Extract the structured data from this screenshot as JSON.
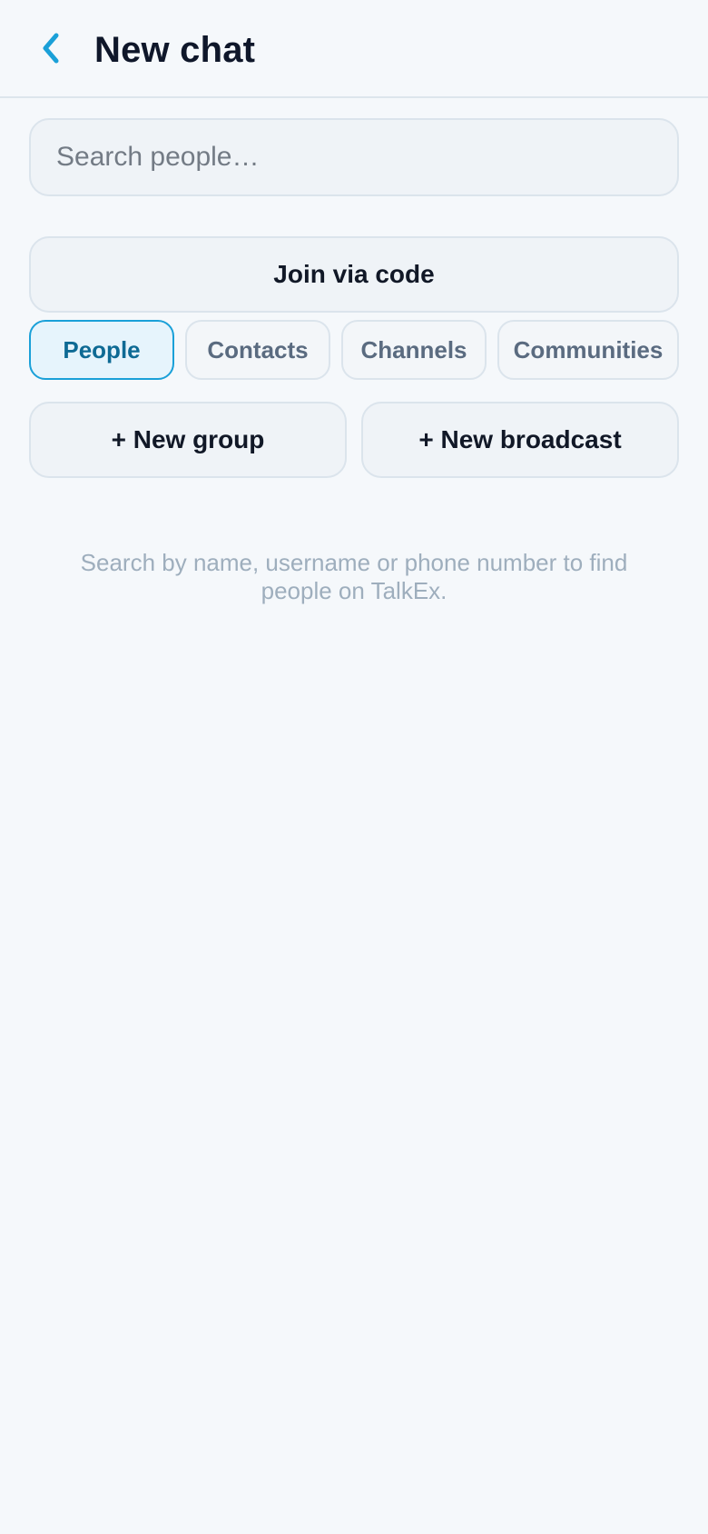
{
  "header": {
    "title": "New chat",
    "back_icon": "chevron-left-icon"
  },
  "search": {
    "value": "",
    "placeholder": "Search people…"
  },
  "join_label": "Join via code",
  "tabs": [
    {
      "label": "People",
      "active": true
    },
    {
      "label": "Contacts",
      "active": false
    },
    {
      "label": "Channels",
      "active": false
    },
    {
      "label": "Communities",
      "active": false
    }
  ],
  "actions": {
    "new_group": "+ New group",
    "new_broadcast": "+ New broadcast"
  },
  "hint": "Search by name, username or phone number to find people on TalkEx.",
  "colors": {
    "accent": "#1aa0d8",
    "background": "#f5f8fb",
    "hint": "#9eaebd"
  }
}
